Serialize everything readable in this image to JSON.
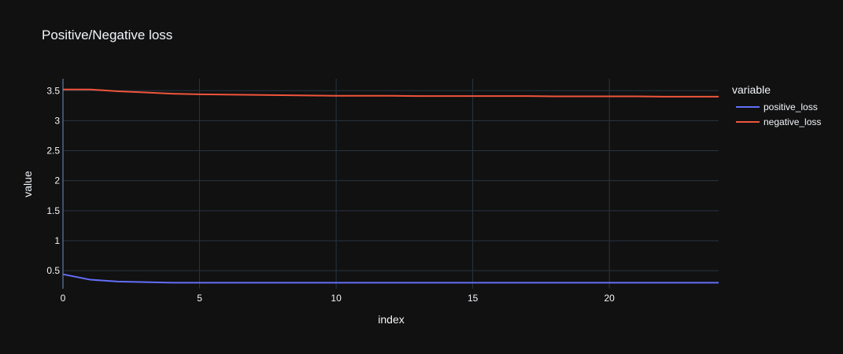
{
  "chart_data": {
    "type": "line",
    "title": "Positive/Negative loss",
    "xlabel": "index",
    "ylabel": "value",
    "xlim": [
      0,
      24
    ],
    "ylim": [
      0.2,
      3.7
    ],
    "grid": true,
    "x": [
      0,
      1,
      2,
      3,
      4,
      5,
      6,
      7,
      8,
      9,
      10,
      11,
      12,
      13,
      14,
      15,
      16,
      17,
      18,
      19,
      20,
      21,
      22,
      23,
      24
    ],
    "x_ticks": [
      0,
      5,
      10,
      15,
      20
    ],
    "x_tick_labels": [
      "0",
      "5",
      "10",
      "15",
      "20"
    ],
    "y_ticks": [
      0.5,
      1,
      1.5,
      2,
      2.5,
      3,
      3.5
    ],
    "y_tick_labels": [
      "0.5",
      "1",
      "1.5",
      "2",
      "2.5",
      "3",
      "3.5"
    ],
    "legend": {
      "title": "variable",
      "position": "right"
    },
    "series": [
      {
        "name": "positive_loss",
        "color": "#636efa",
        "values": [
          0.44,
          0.35,
          0.32,
          0.31,
          0.3,
          0.3,
          0.3,
          0.3,
          0.3,
          0.3,
          0.3,
          0.3,
          0.3,
          0.3,
          0.3,
          0.3,
          0.3,
          0.3,
          0.3,
          0.3,
          0.3,
          0.3,
          0.3,
          0.3,
          0.3
        ]
      },
      {
        "name": "negative_loss",
        "color": "#ef553b",
        "values": [
          3.52,
          3.52,
          3.49,
          3.47,
          3.45,
          3.44,
          3.435,
          3.43,
          3.425,
          3.42,
          3.415,
          3.415,
          3.415,
          3.41,
          3.41,
          3.41,
          3.41,
          3.41,
          3.405,
          3.405,
          3.405,
          3.405,
          3.4,
          3.4,
          3.4
        ]
      }
    ]
  }
}
